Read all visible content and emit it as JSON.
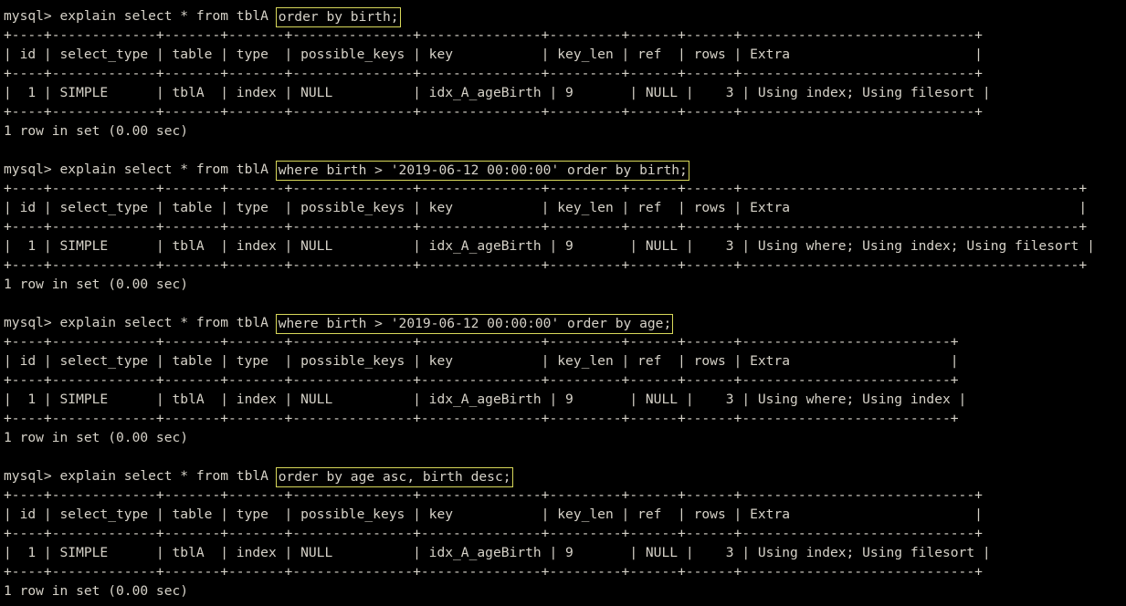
{
  "terminal": {
    "prompt": "mysql> ",
    "foreground_color": "#d6d2c8",
    "background_color": "#000000",
    "highlight_border_color": "#d8d85a",
    "result_line": "1 row in set (0.00 sec)"
  },
  "blocks": [
    {
      "command_prefix": "explain select * from tblA ",
      "command_highlight": "order by birth;",
      "table": {
        "rule": "+----+-------------+-------+-------+---------------+---------------+---------+------+------+-----------------------------+",
        "header": "| id | select_type | table | type  | possible_keys | key           | key_len | ref  | rows | Extra                       |",
        "row": "|  1 | SIMPLE      | tblA  | index | NULL          | idx_A_ageBirth | 9       | NULL |    3 | Using index; Using filesort |",
        "columns": [
          "id",
          "select_type",
          "table",
          "type",
          "possible_keys",
          "key",
          "key_len",
          "ref",
          "rows",
          "Extra"
        ],
        "values": [
          "1",
          "SIMPLE",
          "tblA",
          "index",
          "NULL",
          "idx_A_ageBirth",
          "9",
          "NULL",
          "3",
          "Using index; Using filesort"
        ]
      },
      "result": "1 row in set (0.00 sec)"
    },
    {
      "command_prefix": "explain select * from tblA ",
      "command_highlight": "where birth > '2019-06-12 00:00:00' order by birth;",
      "table": {
        "rule": "+----+-------------+-------+-------+---------------+---------------+---------+------+------+------------------------------------------+",
        "header": "| id | select_type | table | type  | possible_keys | key           | key_len | ref  | rows | Extra                                    |",
        "row": "|  1 | SIMPLE      | tblA  | index | NULL          | idx_A_ageBirth | 9       | NULL |    3 | Using where; Using index; Using filesort |",
        "columns": [
          "id",
          "select_type",
          "table",
          "type",
          "possible_keys",
          "key",
          "key_len",
          "ref",
          "rows",
          "Extra"
        ],
        "values": [
          "1",
          "SIMPLE",
          "tblA",
          "index",
          "NULL",
          "idx_A_ageBirth",
          "9",
          "NULL",
          "3",
          "Using where; Using index; Using filesort"
        ]
      },
      "result": "1 row in set (0.00 sec)"
    },
    {
      "command_prefix": "explain select * from tblA ",
      "command_highlight": "where birth > '2019-06-12 00:00:00' order by age;",
      "table": {
        "rule": "+----+-------------+-------+-------+---------------+---------------+---------+------+------+--------------------------+",
        "header": "| id | select_type | table | type  | possible_keys | key           | key_len | ref  | rows | Extra                    |",
        "row": "|  1 | SIMPLE      | tblA  | index | NULL          | idx_A_ageBirth | 9       | NULL |    3 | Using where; Using index |",
        "columns": [
          "id",
          "select_type",
          "table",
          "type",
          "possible_keys",
          "key",
          "key_len",
          "ref",
          "rows",
          "Extra"
        ],
        "values": [
          "1",
          "SIMPLE",
          "tblA",
          "index",
          "NULL",
          "idx_A_ageBirth",
          "9",
          "NULL",
          "3",
          "Using where; Using index"
        ]
      },
      "result": "1 row in set (0.00 sec)"
    },
    {
      "command_prefix": "explain select * from tblA ",
      "command_highlight": "order by age asc, birth desc;",
      "table": {
        "rule": "+----+-------------+-------+-------+---------------+---------------+---------+------+------+-----------------------------+",
        "header": "| id | select_type | table | type  | possible_keys | key           | key_len | ref  | rows | Extra                       |",
        "row": "|  1 | SIMPLE      | tblA  | index | NULL          | idx_A_ageBirth | 9       | NULL |    3 | Using index; Using filesort |",
        "columns": [
          "id",
          "select_type",
          "table",
          "type",
          "possible_keys",
          "key",
          "key_len",
          "ref",
          "rows",
          "Extra"
        ],
        "values": [
          "1",
          "SIMPLE",
          "tblA",
          "index",
          "NULL",
          "idx_A_ageBirth",
          "9",
          "NULL",
          "3",
          "Using index; Using filesort"
        ]
      },
      "result": "1 row in set (0.00 sec)"
    }
  ]
}
